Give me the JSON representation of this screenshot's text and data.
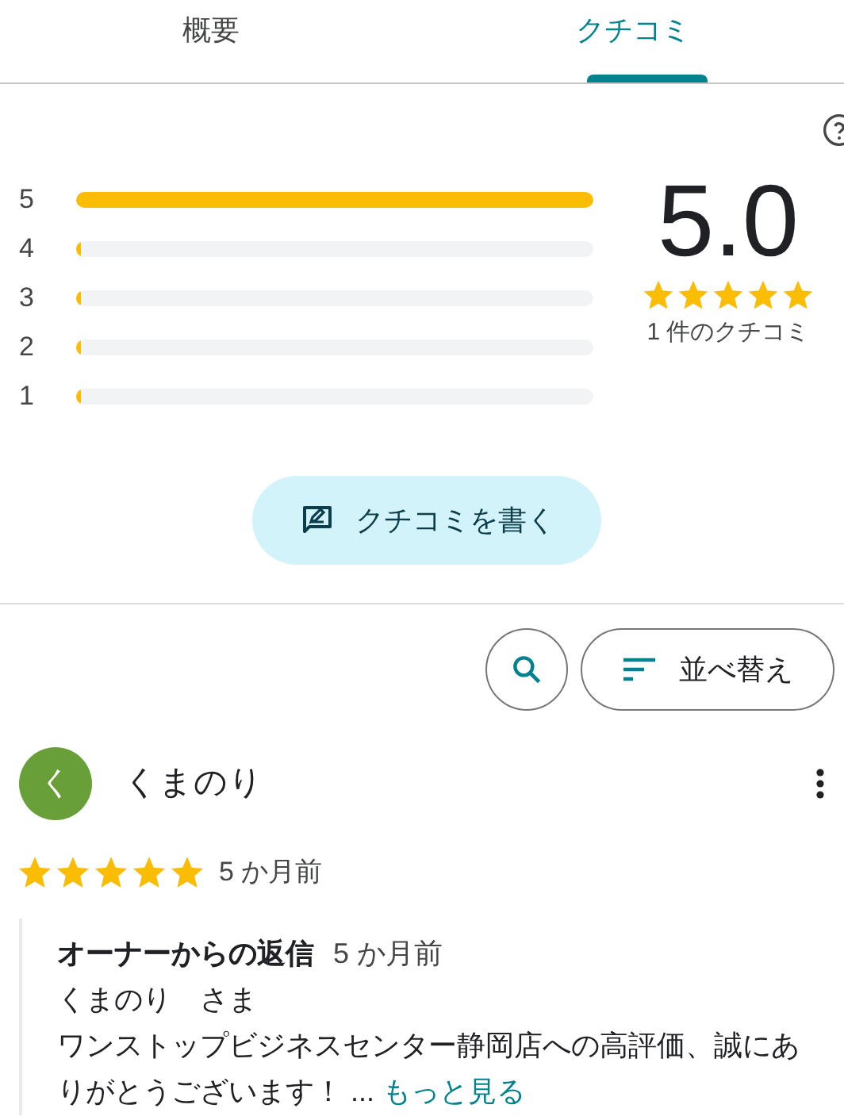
{
  "tabs": [
    {
      "label": "概要",
      "selected": false
    },
    {
      "label": "クチコミ",
      "selected": true
    }
  ],
  "rating_summary": {
    "histogram": [
      {
        "label": "5",
        "level": 1.0
      },
      {
        "label": "4",
        "level": 0.0
      },
      {
        "label": "3",
        "level": 0.0
      },
      {
        "label": "2",
        "level": 0.0
      },
      {
        "label": "1",
        "level": 0.0
      }
    ],
    "score": "5.0",
    "stars": 5,
    "count": "1 件のクチコミ"
  },
  "write_button": "クチコミを書く",
  "sort_button": "並べ替え",
  "review": {
    "avatar_initial": "く",
    "author": "くまのり",
    "stars": 5,
    "time": "5 か月前",
    "owner_reply": {
      "title": "オーナーからの返信",
      "time": "5 か月前",
      "greeting": "くまのり　さま",
      "body": "ワンストップビジネスセンター静岡店への高評価、誠にありがとうございます！ ...",
      "more_link": "もっと見る"
    }
  }
}
